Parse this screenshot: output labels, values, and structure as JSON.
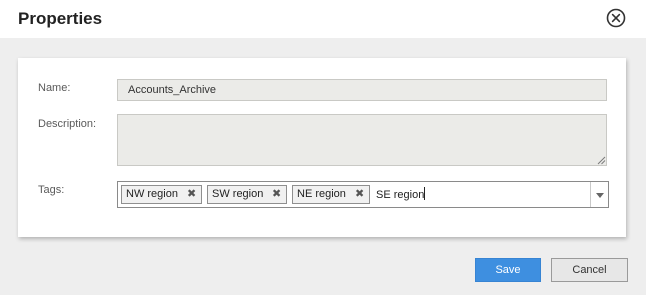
{
  "dialog": {
    "title": "Properties",
    "close_icon": "close-circle-icon"
  },
  "form": {
    "name_label": "Name:",
    "name_value": "Accounts_Archive",
    "description_label": "Description:",
    "description_value": "",
    "tags_label": "Tags:",
    "tags": [
      "NW region",
      "SW region",
      "NE region"
    ],
    "tag_remove_glyph": "✖",
    "tags_input_value": "SE region"
  },
  "footer": {
    "save_label": "Save",
    "cancel_label": "Cancel"
  },
  "colors": {
    "primary_button": "#3e8fe0",
    "background": "#eeeeee"
  }
}
